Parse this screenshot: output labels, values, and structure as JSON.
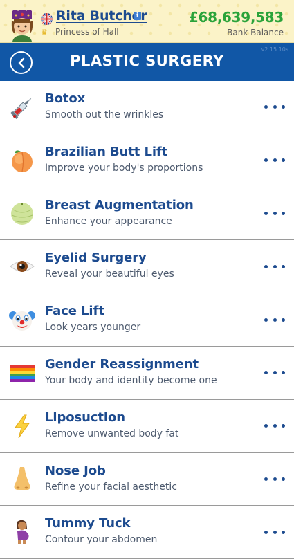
{
  "header": {
    "player_name": "Rita Butcher",
    "player_title": "Princess of Hall",
    "bank_balance": "£68,639,583",
    "bank_label": "Bank Balance",
    "info_glyph": "i"
  },
  "titlebar": {
    "title": "Plastic Surgery",
    "version": "v2.15 10s"
  },
  "colors": {
    "header_bg": "#fbf3c8",
    "titlebar_bg": "#1157a6",
    "item_title": "#1d4b8f",
    "balance_green": "#2aa33a"
  },
  "procedures": [
    {
      "icon": "syringe-icon",
      "title": "Botox",
      "subtitle": "Smooth out the wrinkles"
    },
    {
      "icon": "peach-icon",
      "title": "Brazilian Butt Lift",
      "subtitle": "Improve your body's proportions"
    },
    {
      "icon": "melon-icon",
      "title": "Breast Augmentation",
      "subtitle": "Enhance your appearance"
    },
    {
      "icon": "eye-icon",
      "title": "Eyelid Surgery",
      "subtitle": "Reveal your beautiful eyes"
    },
    {
      "icon": "clown-icon",
      "title": "Face Lift",
      "subtitle": "Look years younger"
    },
    {
      "icon": "rainbow-flag-icon",
      "title": "Gender Reassignment",
      "subtitle": "Your body and identity become one"
    },
    {
      "icon": "lightning-icon",
      "title": "Liposuction",
      "subtitle": "Remove unwanted body fat"
    },
    {
      "icon": "nose-icon",
      "title": "Nose Job",
      "subtitle": "Refine your facial aesthetic"
    },
    {
      "icon": "pregnant-woman-icon",
      "title": "Tummy Tuck",
      "subtitle": "Contour your abdomen"
    }
  ]
}
